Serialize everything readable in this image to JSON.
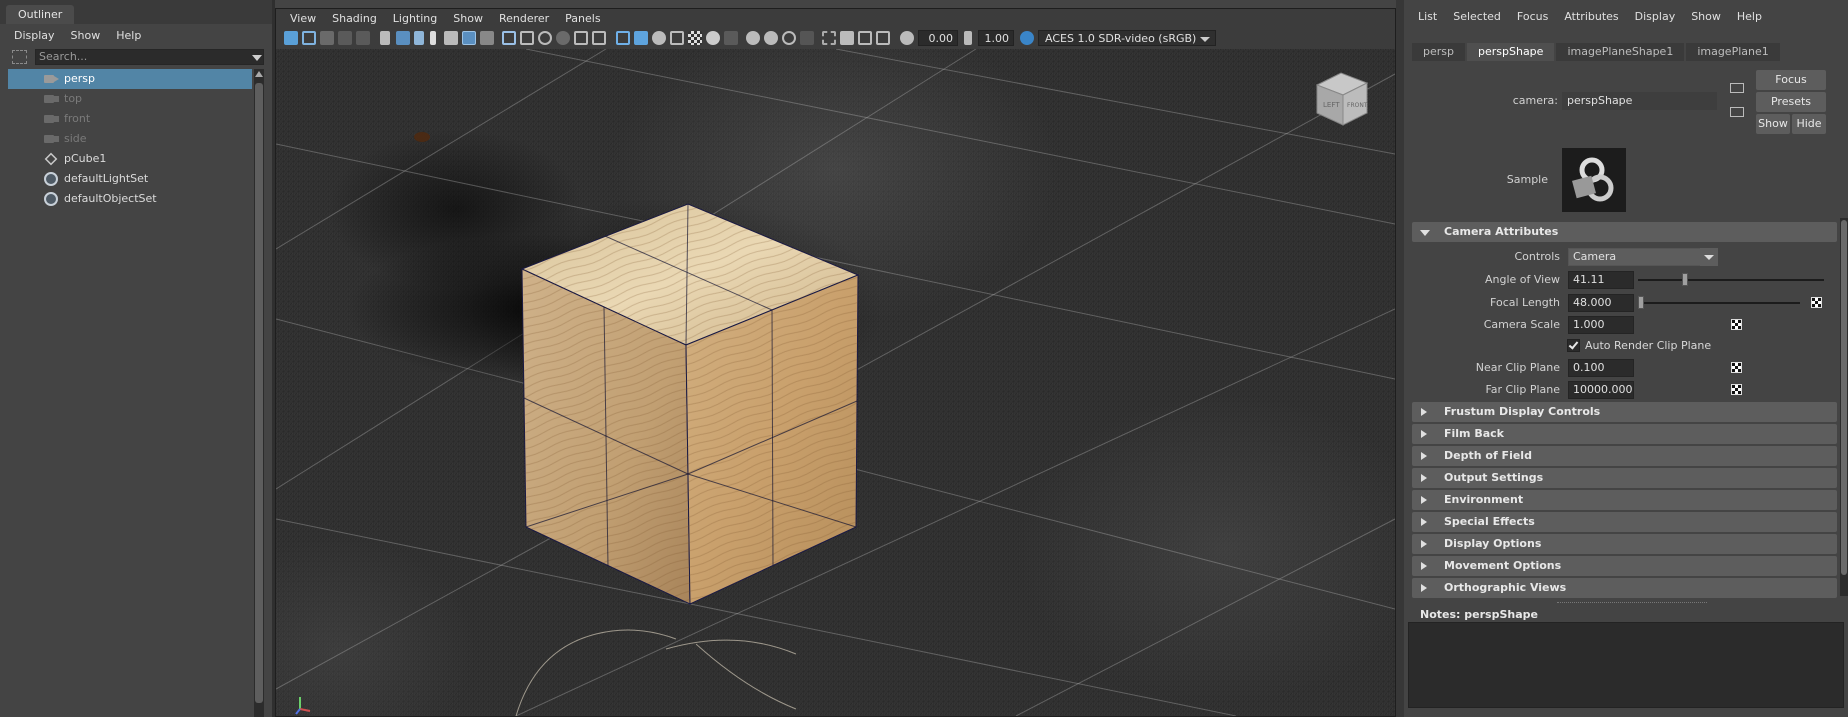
{
  "outliner": {
    "tab": "Outliner",
    "menu": [
      "Display",
      "Show",
      "Help"
    ],
    "search_placeholder": "Search...",
    "items": [
      {
        "label": "persp",
        "icon": "camera-icon",
        "selected": true,
        "dim": false
      },
      {
        "label": "top",
        "icon": "camera-icon",
        "selected": false,
        "dim": true
      },
      {
        "label": "front",
        "icon": "camera-icon",
        "selected": false,
        "dim": true
      },
      {
        "label": "side",
        "icon": "camera-icon",
        "selected": false,
        "dim": true
      },
      {
        "label": "pCube1",
        "icon": "mesh-icon",
        "selected": false,
        "dim": false
      },
      {
        "label": "defaultLightSet",
        "icon": "set-icon",
        "selected": false,
        "dim": false
      },
      {
        "label": "defaultObjectSet",
        "icon": "set-icon",
        "selected": false,
        "dim": false
      }
    ]
  },
  "viewport": {
    "menu": [
      "View",
      "Shading",
      "Lighting",
      "Show",
      "Renderer",
      "Panels"
    ],
    "exposure": "0.00",
    "gamma": "1.00",
    "color_space": "ACES 1.0 SDR-video (sRGB)",
    "viewcube_left": "LEFT",
    "viewcube_front": "FRONT"
  },
  "attribute_editor": {
    "menu": [
      "List",
      "Selected",
      "Focus",
      "Attributes",
      "Display",
      "Show",
      "Help"
    ],
    "tabs": [
      "persp",
      "perspShape",
      "imagePlaneShape1",
      "imagePlane1"
    ],
    "active_tab": "perspShape",
    "camera_label": "camera:",
    "camera_value": "perspShape",
    "buttons": {
      "focus": "Focus",
      "presets": "Presets",
      "show": "Show",
      "hide": "Hide"
    },
    "sample_label": "Sample",
    "camera_attributes": {
      "title": "Camera Attributes",
      "controls_label": "Controls",
      "controls_value": "Camera",
      "angle_label": "Angle of View",
      "angle_value": "41.11",
      "focal_label": "Focal Length",
      "focal_value": "48.000",
      "scale_label": "Camera Scale",
      "scale_value": "1.000",
      "auto_clip_label": "Auto Render Clip Plane",
      "auto_clip_checked": true,
      "near_label": "Near Clip Plane",
      "near_value": "0.100",
      "far_label": "Far Clip Plane",
      "far_value": "10000.000"
    },
    "sections": [
      "Frustum Display Controls",
      "Film Back",
      "Depth of Field",
      "Output Settings",
      "Environment",
      "Special Effects",
      "Display Options",
      "Movement Options",
      "Orthographic Views"
    ],
    "notes_label": "Notes:  perspShape"
  },
  "colors": {
    "selection": "#5285a6",
    "panel_bg": "#444444",
    "section_bg": "#5d5d5d",
    "field_bg": "#2b2b2b"
  }
}
